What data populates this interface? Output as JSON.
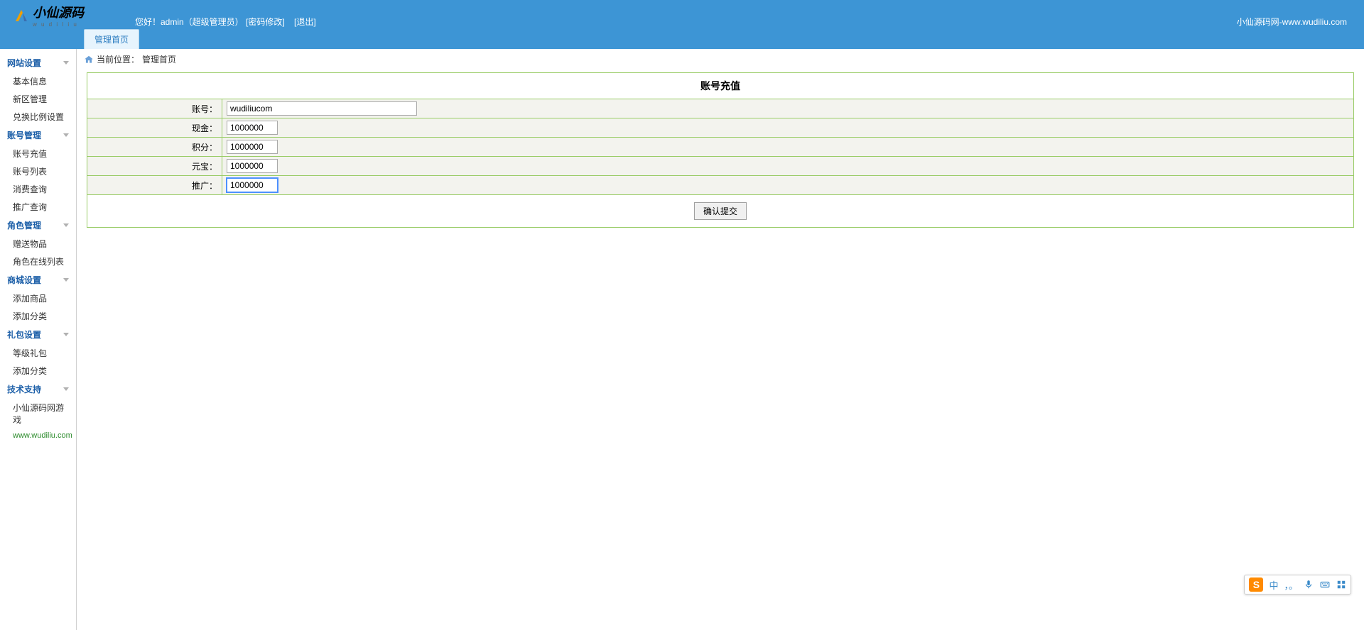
{
  "header": {
    "greeting": "您好！admin（超级管理员）",
    "change_pwd": "[密码修改]",
    "logout": "[退出]",
    "site_right": "小仙源码网-www.wudiliu.com",
    "logo_main": "小仙源码",
    "logo_sub": "w u d i l i u"
  },
  "tabs": {
    "home": "管理首页"
  },
  "breadcrumb": {
    "prefix": "当前位置：",
    "current": "管理首页"
  },
  "sidebar": {
    "g1": {
      "title": "网站设置",
      "items": [
        "基本信息",
        "新区管理",
        "兑换比例设置"
      ]
    },
    "g2": {
      "title": "账号管理",
      "items": [
        "账号充值",
        "账号列表",
        "消费查询",
        "推广查询"
      ]
    },
    "g3": {
      "title": "角色管理",
      "items": [
        "赠送物品",
        "角色在线列表"
      ]
    },
    "g4": {
      "title": "商城设置",
      "items": [
        "添加商品",
        "添加分类"
      ]
    },
    "g5": {
      "title": "礼包设置",
      "items": [
        "等级礼包",
        "添加分类"
      ]
    },
    "g6": {
      "title": "技术支持",
      "items": [
        "小仙源码网游戏"
      ],
      "link": "www.wudiliu.com"
    }
  },
  "form": {
    "title": "账号充值",
    "labels": {
      "account": "账号：",
      "cash": "现金：",
      "points": "积分：",
      "gold": "元宝：",
      "promo": "推广："
    },
    "values": {
      "account": "wudiliucom",
      "cash": "1000000",
      "points": "1000000",
      "gold": "1000000",
      "promo": "1000000"
    },
    "submit": "确认提交"
  },
  "ime": {
    "mode": "中",
    "punct": "，。",
    "items": [
      "mic",
      "keyboard",
      "grid"
    ]
  }
}
